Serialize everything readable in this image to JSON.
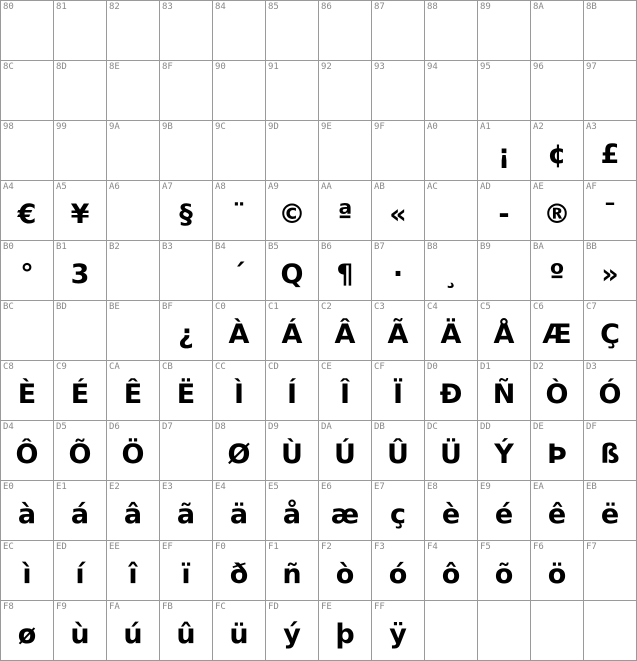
{
  "cells": [
    {
      "code": "80",
      "char": ""
    },
    {
      "code": "81",
      "char": ""
    },
    {
      "code": "82",
      "char": ""
    },
    {
      "code": "83",
      "char": ""
    },
    {
      "code": "84",
      "char": ""
    },
    {
      "code": "85",
      "char": ""
    },
    {
      "code": "86",
      "char": ""
    },
    {
      "code": "87",
      "char": ""
    },
    {
      "code": "88",
      "char": ""
    },
    {
      "code": "89",
      "char": ""
    },
    {
      "code": "8A",
      "char": ""
    },
    {
      "code": "8B",
      "char": ""
    },
    {
      "code": "8C",
      "char": ""
    },
    {
      "code": "8D",
      "char": ""
    },
    {
      "code": "8E",
      "char": ""
    },
    {
      "code": "8F",
      "char": ""
    },
    {
      "code": "90",
      "char": ""
    },
    {
      "code": "91",
      "char": ""
    },
    {
      "code": "92",
      "char": ""
    },
    {
      "code": "93",
      "char": ""
    },
    {
      "code": "94",
      "char": ""
    },
    {
      "code": "95",
      "char": ""
    },
    {
      "code": "96",
      "char": ""
    },
    {
      "code": "97",
      "char": ""
    },
    {
      "code": "98",
      "char": ""
    },
    {
      "code": "99",
      "char": ""
    },
    {
      "code": "9A",
      "char": ""
    },
    {
      "code": "9B",
      "char": ""
    },
    {
      "code": "9C",
      "char": ""
    },
    {
      "code": "9D",
      "char": ""
    },
    {
      "code": "9E",
      "char": ""
    },
    {
      "code": "9F",
      "char": ""
    },
    {
      "code": "A0",
      "char": ""
    },
    {
      "code": "A1",
      "char": "¡"
    },
    {
      "code": "A2",
      "char": "¢"
    },
    {
      "code": "A3",
      "char": "£"
    },
    {
      "code": "A4",
      "char": "€"
    },
    {
      "code": "A5",
      "char": "¥"
    },
    {
      "code": "A6",
      "char": ""
    },
    {
      "code": "A7",
      "char": "§"
    },
    {
      "code": "A8",
      "char": "¨"
    },
    {
      "code": "A9",
      "char": "©"
    },
    {
      "code": "AA",
      "char": "ª"
    },
    {
      "code": "AB",
      "char": "«"
    },
    {
      "code": "AC",
      "char": ""
    },
    {
      "code": "AD",
      "char": "-"
    },
    {
      "code": "AE",
      "char": "®"
    },
    {
      "code": "AF",
      "char": "¯"
    },
    {
      "code": "B0",
      "char": "°"
    },
    {
      "code": "B1",
      "char": "3"
    },
    {
      "code": "B2",
      "char": ""
    },
    {
      "code": "B3",
      "char": ""
    },
    {
      "code": "B4",
      "char": "´"
    },
    {
      "code": "B5",
      "char": "Q"
    },
    {
      "code": "B6",
      "char": "¶"
    },
    {
      "code": "B7",
      "char": "·"
    },
    {
      "code": "B8",
      "char": "¸"
    },
    {
      "code": "B9",
      "char": ""
    },
    {
      "code": "BA",
      "char": "º"
    },
    {
      "code": "BB",
      "char": "»"
    },
    {
      "code": "BC",
      "char": ""
    },
    {
      "code": "BD",
      "char": ""
    },
    {
      "code": "BE",
      "char": ""
    },
    {
      "code": "BF",
      "char": "¿"
    },
    {
      "code": "C0",
      "char": "À"
    },
    {
      "code": "C1",
      "char": "Á"
    },
    {
      "code": "C2",
      "char": "Â"
    },
    {
      "code": "C3",
      "char": "Ã"
    },
    {
      "code": "C4",
      "char": "Ä"
    },
    {
      "code": "C5",
      "char": "Å"
    },
    {
      "code": "C6",
      "char": "Æ"
    },
    {
      "code": "C7",
      "char": "Ç"
    },
    {
      "code": "C8",
      "char": "È"
    },
    {
      "code": "C9",
      "char": "É"
    },
    {
      "code": "CA",
      "char": "Ê"
    },
    {
      "code": "CB",
      "char": "Ë"
    },
    {
      "code": "CC",
      "char": "Ì"
    },
    {
      "code": "CD",
      "char": "Í"
    },
    {
      "code": "CE",
      "char": "Î"
    },
    {
      "code": "CF",
      "char": "Ï"
    },
    {
      "code": "D0",
      "char": "Đ"
    },
    {
      "code": "D1",
      "char": "Ñ"
    },
    {
      "code": "D2",
      "char": "Ò"
    },
    {
      "code": "D3",
      "char": "Ó"
    },
    {
      "code": "D4",
      "char": "Ô"
    },
    {
      "code": "D5",
      "char": "Õ"
    },
    {
      "code": "D6",
      "char": "Ö"
    },
    {
      "code": "D7",
      "char": ""
    },
    {
      "code": "D8",
      "char": "Ø"
    },
    {
      "code": "D9",
      "char": "Ù"
    },
    {
      "code": "DA",
      "char": "Ú"
    },
    {
      "code": "DB",
      "char": "Û"
    },
    {
      "code": "DC",
      "char": "Ü"
    },
    {
      "code": "DD",
      "char": "Ý"
    },
    {
      "code": "DE",
      "char": "Þ"
    },
    {
      "code": "DF",
      "char": "ß"
    },
    {
      "code": "E0",
      "char": "à"
    },
    {
      "code": "E1",
      "char": "á"
    },
    {
      "code": "E2",
      "char": "â"
    },
    {
      "code": "E3",
      "char": "ã"
    },
    {
      "code": "E4",
      "char": "ä"
    },
    {
      "code": "E5",
      "char": "å"
    },
    {
      "code": "E6",
      "char": "æ"
    },
    {
      "code": "E7",
      "char": "ç"
    },
    {
      "code": "E8",
      "char": "è"
    },
    {
      "code": "E9",
      "char": "é"
    },
    {
      "code": "EA",
      "char": "ê"
    },
    {
      "code": "EB",
      "char": "ë"
    },
    {
      "code": "EC",
      "char": "ì"
    },
    {
      "code": "ED",
      "char": "í"
    },
    {
      "code": "EE",
      "char": "î"
    },
    {
      "code": "EF",
      "char": "ï"
    },
    {
      "code": "F0",
      "char": "ð"
    },
    {
      "code": "F1",
      "char": "ñ"
    },
    {
      "code": "F2",
      "char": "ò"
    },
    {
      "code": "F3",
      "char": "ó"
    },
    {
      "code": "F4",
      "char": "ô"
    },
    {
      "code": "F5",
      "char": "õ"
    },
    {
      "code": "F6",
      "char": "ö"
    },
    {
      "code": "F7",
      "char": ""
    },
    {
      "code": "F8",
      "char": "ø"
    },
    {
      "code": "F9",
      "char": "ù"
    },
    {
      "code": "FA",
      "char": "ú"
    },
    {
      "code": "FB",
      "char": "û"
    },
    {
      "code": "FC",
      "char": "ü"
    },
    {
      "code": "FD",
      "char": "ý"
    },
    {
      "code": "FE",
      "char": "þ"
    },
    {
      "code": "FF",
      "char": "ÿ"
    },
    {
      "code": "",
      "char": ""
    },
    {
      "code": "",
      "char": ""
    },
    {
      "code": "",
      "char": ""
    },
    {
      "code": "",
      "char": ""
    }
  ]
}
